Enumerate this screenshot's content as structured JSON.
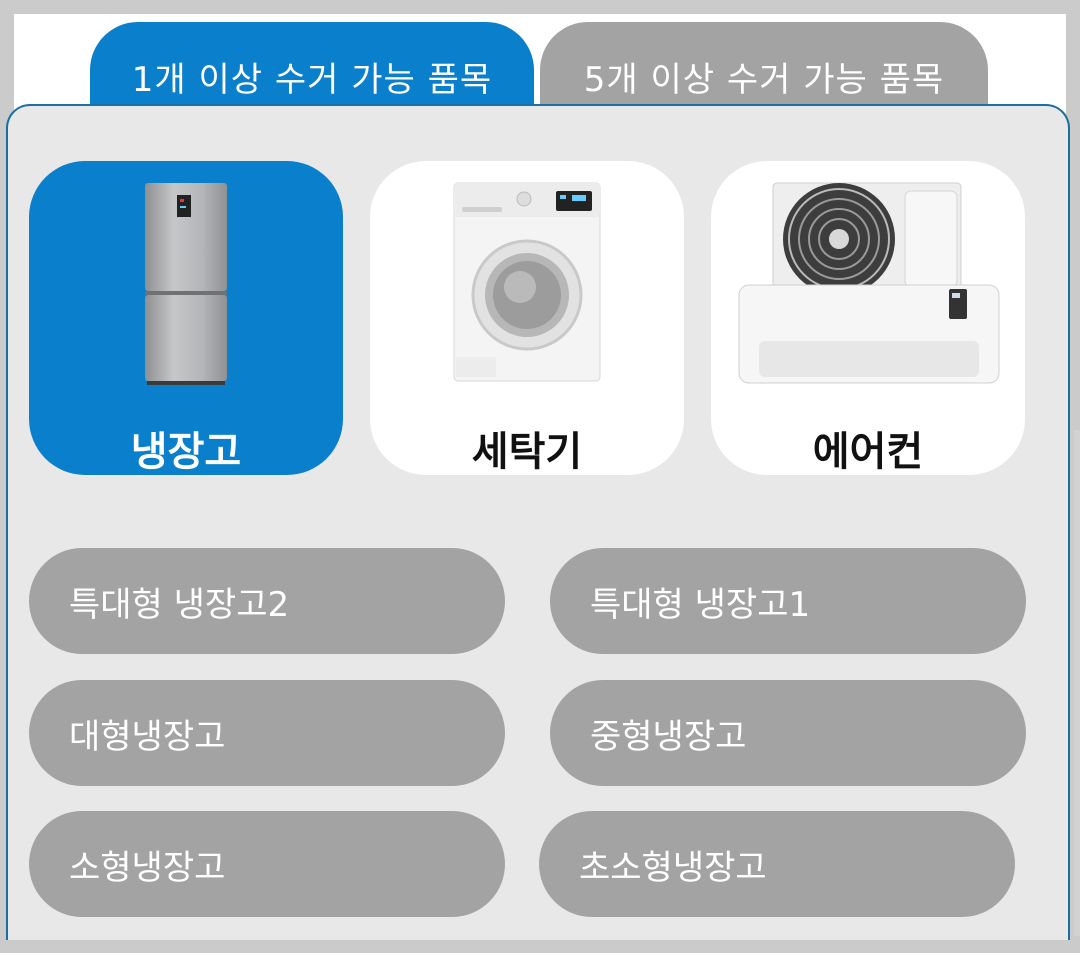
{
  "tabs": [
    {
      "label": "1개 이상 수거 가능 품목",
      "active": true
    },
    {
      "label": "5개 이상 수거 가능 품목",
      "active": false
    }
  ],
  "categories": [
    {
      "label": "냉장고",
      "icon": "refrigerator-icon",
      "selected": true
    },
    {
      "label": "세탁기",
      "icon": "washing-machine-icon",
      "selected": false
    },
    {
      "label": "에어컨",
      "icon": "air-conditioner-icon",
      "selected": false
    }
  ],
  "items": [
    {
      "label": "특대형 냉장고2"
    },
    {
      "label": "특대형 냉장고1"
    },
    {
      "label": "대형냉장고"
    },
    {
      "label": "중형냉장고"
    },
    {
      "label": "소형냉장고"
    },
    {
      "label": "초소형냉장고"
    }
  ],
  "colors": {
    "accent": "#0a7fcb",
    "tab_inactive": "#a3a3a3",
    "pill": "#a3a3a3",
    "panel_bg": "#e8e8e8"
  }
}
